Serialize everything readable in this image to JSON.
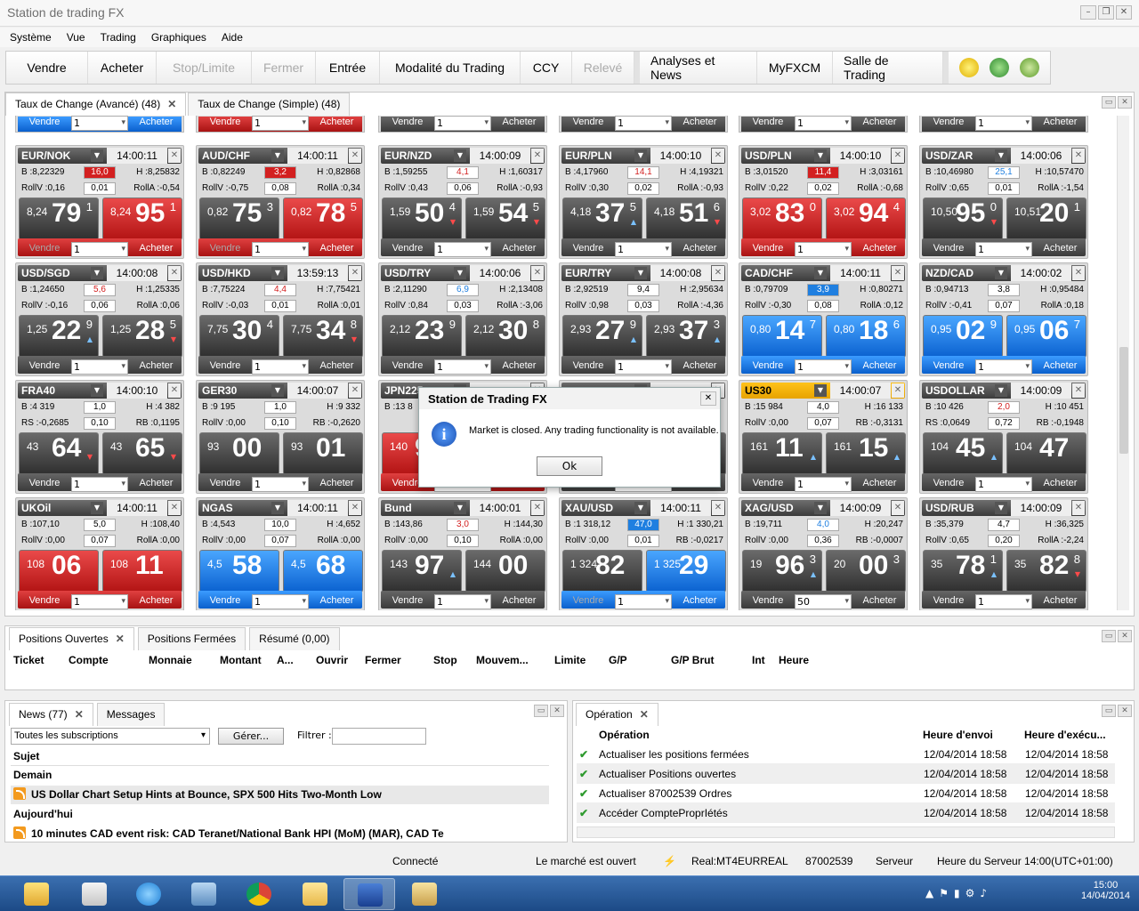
{
  "window": {
    "title": "Station de trading FX"
  },
  "menu": [
    "Système",
    "Vue",
    "Trading",
    "Graphiques",
    "Aide"
  ],
  "toolbar": {
    "buttons": [
      {
        "label": "Vendre",
        "enabled": true
      },
      {
        "label": "Acheter",
        "enabled": true
      },
      {
        "label": "Stop/Limite",
        "enabled": false
      },
      {
        "label": "Fermer",
        "enabled": false
      },
      {
        "label": "Entrée",
        "enabled": true
      },
      {
        "label": "Modalité du Trading",
        "enabled": true
      },
      {
        "label": "CCY",
        "enabled": true
      },
      {
        "label": "Relevé",
        "enabled": false
      }
    ],
    "buttons2": [
      "Analyses et News",
      "MyFXCM",
      "Salle de Trading"
    ],
    "icons": [
      "lightbulb-icon",
      "refresh-icon",
      "settings-gears-icon"
    ]
  },
  "rates_tabs": [
    {
      "label": "Taux de Change (Avancé) (48)",
      "close": "✕"
    },
    {
      "label": "Taux de Change (Simple) (48)",
      "close": ""
    }
  ],
  "common": {
    "sell": "Vendre",
    "buy": "Acheter",
    "qty": "1"
  },
  "top_strips": [
    {
      "sell": "Vendre",
      "qty": "1",
      "buy": "Acheter",
      "color": "blue"
    },
    {
      "sell": "Vendre",
      "qty": "1",
      "buy": "Acheter",
      "color": "red"
    },
    {
      "sell": "Vendre",
      "qty": "1",
      "buy": "Acheter",
      "color": "gray"
    },
    {
      "sell": "Vendre",
      "qty": "1",
      "buy": "Acheter",
      "color": "gray"
    },
    {
      "sell": "Vendre",
      "qty": "1",
      "buy": "Acheter",
      "color": "gray"
    },
    {
      "sell": "Vendre",
      "qty": "1",
      "buy": "Acheter",
      "color": "gray"
    }
  ],
  "cards": [
    {
      "sym": "EUR/NOK",
      "time": "14:00:11",
      "bL": "B :8,22329",
      "mid1": "16,0",
      "mid1c": "red",
      "hR": "H :8,25832",
      "r2L": "RollV :0,16",
      "mid2": "0,01",
      "r2R": "RollA :-0,54",
      "sBig": "8,24",
      "sPip": "79",
      "sFr": "1",
      "sCol": "gray",
      "sAr": "",
      "bBig": "8,24",
      "bPip": "95",
      "bFr": "1",
      "bCol": "red",
      "bAr": "",
      "foot": "red",
      "qty": "1",
      "sellDim": true
    },
    {
      "sym": "AUD/CHF",
      "time": "14:00:11",
      "bL": "B :0,82249",
      "mid1": "3,2",
      "mid1c": "red",
      "hR": "H :0,82868",
      "r2L": "RollV :-0,75",
      "mid2": "0,08",
      "r2R": "RollA :0,34",
      "sBig": "0,82",
      "sPip": "75",
      "sFr": "3",
      "sCol": "gray",
      "sAr": "",
      "bBig": "0,82",
      "bPip": "78",
      "bFr": "5",
      "bCol": "red",
      "bAr": "",
      "foot": "red",
      "qty": "1",
      "sellDim": true
    },
    {
      "sym": "EUR/NZD",
      "time": "14:00:09",
      "bL": "B :1,59255",
      "mid1": "4,1",
      "mid1c": "redt",
      "hR": "H :1,60317",
      "r2L": "RollV :0,43",
      "mid2": "0,06",
      "r2R": "RollA :-0,93",
      "sBig": "1,59",
      "sPip": "50",
      "sFr": "4",
      "sCol": "gray",
      "sAr": "dn",
      "bBig": "1,59",
      "bPip": "54",
      "bFr": "5",
      "bCol": "gray",
      "bAr": "dn",
      "foot": "gray",
      "qty": "1",
      "sellDim": false
    },
    {
      "sym": "EUR/PLN",
      "time": "14:00:10",
      "bL": "B :4,17960",
      "mid1": "14,1",
      "mid1c": "redt",
      "hR": "H :4,19321",
      "r2L": "RollV :0,30",
      "mid2": "0,02",
      "r2R": "RollA :-0,93",
      "sBig": "4,18",
      "sPip": "37",
      "sFr": "5",
      "sCol": "gray",
      "sAr": "up",
      "bBig": "4,18",
      "bPip": "51",
      "bFr": "6",
      "bCol": "gray",
      "bAr": "dn",
      "foot": "gray",
      "qty": "1",
      "sellDim": false
    },
    {
      "sym": "USD/PLN",
      "time": "14:00:10",
      "bL": "B :3,01520",
      "mid1": "11,4",
      "mid1c": "red",
      "hR": "H :3,03161",
      "r2L": "RollV :0,22",
      "mid2": "0,02",
      "r2R": "RollA :-0,68",
      "sBig": "3,02",
      "sPip": "83",
      "sFr": "0",
      "sCol": "red",
      "sAr": "",
      "bBig": "3,02",
      "bPip": "94",
      "bFr": "4",
      "bCol": "red",
      "bAr": "",
      "foot": "red",
      "qty": "1",
      "sellDim": false
    },
    {
      "sym": "USD/ZAR",
      "time": "14:00:06",
      "bL": "B :10,46980",
      "mid1": "25,1",
      "mid1c": "bluet",
      "hR": "H :10,57470",
      "r2L": "RollV :0,65",
      "mid2": "0,01",
      "r2R": "RollA :-1,54",
      "sBig": "10,50",
      "sPip": "95",
      "sFr": "0",
      "sCol": "gray",
      "sAr": "dn",
      "bBig": "10,51",
      "bPip": "20",
      "bFr": "1",
      "bCol": "gray",
      "bAr": "",
      "foot": "gray",
      "qty": "1",
      "sellDim": false
    },
    {
      "sym": "USD/SGD",
      "time": "14:00:08",
      "bL": "B :1,24650",
      "mid1": "5,6",
      "mid1c": "redt",
      "hR": "H :1,25335",
      "r2L": "RollV :-0,16",
      "mid2": "0,06",
      "r2R": "RollA :0,06",
      "sBig": "1,25",
      "sPip": "22",
      "sFr": "9",
      "sCol": "gray",
      "sAr": "up",
      "bBig": "1,25",
      "bPip": "28",
      "bFr": "5",
      "bCol": "gray",
      "bAr": "dn",
      "foot": "gray",
      "qty": "1",
      "sellDim": false
    },
    {
      "sym": "USD/HKD",
      "time": "13:59:13",
      "bL": "B :7,75224",
      "mid1": "4,4",
      "mid1c": "redt",
      "hR": "H :7,75421",
      "r2L": "RollV :-0,03",
      "mid2": "0,01",
      "r2R": "RollA :0,01",
      "sBig": "7,75",
      "sPip": "30",
      "sFr": "4",
      "sCol": "gray",
      "sAr": "",
      "bBig": "7,75",
      "bPip": "34",
      "bFr": "8",
      "bCol": "gray",
      "bAr": "dn",
      "foot": "gray",
      "qty": "1",
      "sellDim": false
    },
    {
      "sym": "USD/TRY",
      "time": "14:00:06",
      "bL": "B :2,11290",
      "mid1": "6,9",
      "mid1c": "bluet",
      "hR": "H :2,13408",
      "r2L": "RollV :0,84",
      "mid2": "0,03",
      "r2R": "RollA :-3,06",
      "sBig": "2,12",
      "sPip": "23",
      "sFr": "9",
      "sCol": "gray",
      "sAr": "",
      "bBig": "2,12",
      "bPip": "30",
      "bFr": "8",
      "bCol": "gray",
      "bAr": "",
      "foot": "gray",
      "qty": "1",
      "sellDim": false
    },
    {
      "sym": "EUR/TRY",
      "time": "14:00:08",
      "bL": "B :2,92519",
      "mid1": "9,4",
      "mid1c": "",
      "hR": "H :2,95634",
      "r2L": "RollV :0,98",
      "mid2": "0,03",
      "r2R": "RollA :-4,36",
      "sBig": "2,93",
      "sPip": "27",
      "sFr": "9",
      "sCol": "gray",
      "sAr": "up",
      "bBig": "2,93",
      "bPip": "37",
      "bFr": "3",
      "bCol": "gray",
      "bAr": "up",
      "foot": "gray",
      "qty": "1",
      "sellDim": false
    },
    {
      "sym": "CAD/CHF",
      "time": "14:00:11",
      "bL": "B :0,79709",
      "mid1": "3,9",
      "mid1c": "blue",
      "hR": "H :0,80271",
      "r2L": "RollV :-0,30",
      "mid2": "0,08",
      "r2R": "RollA :0,12",
      "sBig": "0,80",
      "sPip": "14",
      "sFr": "7",
      "sCol": "blue",
      "sAr": "",
      "bBig": "0,80",
      "bPip": "18",
      "bFr": "6",
      "bCol": "blue",
      "bAr": "",
      "foot": "blue",
      "qty": "1",
      "sellDim": false
    },
    {
      "sym": "NZD/CAD",
      "time": "14:00:02",
      "bL": "B :0,94713",
      "mid1": "3,8",
      "mid1c": "",
      "hR": "H :0,95484",
      "r2L": "RollV :-0,41",
      "mid2": "0,07",
      "r2R": "RollA :0,18",
      "sBig": "0,95",
      "sPip": "02",
      "sFr": "9",
      "sCol": "blue",
      "sAr": "",
      "bBig": "0,95",
      "bPip": "06",
      "bFr": "7",
      "bCol": "blue",
      "bAr": "",
      "foot": "blue",
      "qty": "1",
      "sellDim": false
    },
    {
      "sym": "FRA40",
      "time": "14:00:10",
      "bL": "B :4 319",
      "mid1": "1,0",
      "mid1c": "",
      "hR": "H :4 382",
      "r2L": "RS :-0,2685",
      "mid2": "0,10",
      "r2R": "RB :0,1195",
      "sBig": "43",
      "sPip": "64",
      "sFr": "",
      "sCol": "gray",
      "sAr": "dn",
      "bBig": "43",
      "bPip": "65",
      "bFr": "",
      "bCol": "gray",
      "bAr": "dn",
      "foot": "gray",
      "qty": "1",
      "sellDim": false
    },
    {
      "sym": "GER30",
      "time": "14:00:07",
      "bL": "B :9 195",
      "mid1": "1,0",
      "mid1c": "",
      "hR": "H :9 332",
      "r2L": "RollV :0,00",
      "mid2": "0,10",
      "r2R": "RB :-0,2620",
      "sBig": "93",
      "sPip": "00",
      "sFr": "",
      "sCol": "gray",
      "sAr": "",
      "bBig": "93",
      "bPip": "01",
      "bFr": "",
      "bCol": "gray",
      "bAr": "",
      "foot": "gray",
      "qty": "1",
      "sellDim": false
    },
    {
      "sym": "JPN225",
      "time": "",
      "bL": "B :13 8",
      "mid1": "",
      "mid1c": "",
      "hR": "",
      "r2L": "",
      "mid2": "",
      "r2R": "",
      "sBig": "140",
      "sPip": "9",
      "sFr": "",
      "sCol": "red",
      "sAr": "",
      "bBig": "",
      "bPip": "",
      "bFr": "",
      "bCol": "gray",
      "bAr": "",
      "foot": "red",
      "qty": "1",
      "sellDim": false
    },
    {
      "sym": "",
      "time": "",
      "bL": "",
      "mid1": "",
      "mid1c": "",
      "hR": "",
      "r2L": "",
      "mid2": "",
      "r2R": "",
      "sBig": "",
      "sPip": "",
      "sFr": "",
      "sCol": "gray",
      "sAr": "",
      "bBig": "",
      "bPip": "",
      "bFr": "",
      "bCol": "gray",
      "bAr": "",
      "foot": "gray",
      "qty": "1",
      "sellDim": false
    },
    {
      "sym": "US30",
      "time": "14:00:07",
      "bL": "B :15 984",
      "mid1": "4,0",
      "mid1c": "",
      "hR": "H :16 133",
      "r2L": "RollV :0,00",
      "mid2": "0,07",
      "r2R": "RB :-0,3131",
      "sBig": "161",
      "sPip": "11",
      "sFr": "",
      "sCol": "gray",
      "sAr": "up",
      "bBig": "161",
      "bPip": "15",
      "bFr": "",
      "bCol": "gray",
      "bAr": "up",
      "foot": "gray",
      "qty": "1",
      "sellDim": false,
      "gold": true
    },
    {
      "sym": "USDOLLAR",
      "time": "14:00:09",
      "bL": "B :10 426",
      "mid1": "2,0",
      "mid1c": "redt",
      "hR": "H :10 451",
      "r2L": "RS :0,0649",
      "mid2": "0,72",
      "r2R": "RB :-0,1948",
      "sBig": "104",
      "sPip": "45",
      "sFr": "",
      "sCol": "gray",
      "sAr": "up",
      "bBig": "104",
      "bPip": "47",
      "bFr": "",
      "bCol": "gray",
      "bAr": "",
      "foot": "gray",
      "qty": "1",
      "sellDim": false
    },
    {
      "sym": "UKOil",
      "time": "14:00:11",
      "bL": "B :107,10",
      "mid1": "5,0",
      "mid1c": "",
      "hR": "H :108,40",
      "r2L": "RollV :0,00",
      "mid2": "0,07",
      "r2R": "RollA :0,00",
      "sBig": "108",
      "sPip": "06",
      "sFr": "",
      "sCol": "red",
      "sAr": "",
      "bBig": "108",
      "bPip": "11",
      "bFr": "",
      "bCol": "red",
      "bAr": "",
      "foot": "red",
      "qty": "1",
      "sellDim": false
    },
    {
      "sym": "NGAS",
      "time": "14:00:11",
      "bL": "B :4,543",
      "mid1": "10,0",
      "mid1c": "",
      "hR": "H :4,652",
      "r2L": "RollV :0,00",
      "mid2": "0,07",
      "r2R": "RollA :0,00",
      "sBig": "4,5",
      "sPip": "58",
      "sFr": "",
      "sCol": "blue",
      "sAr": "",
      "bBig": "4,5",
      "bPip": "68",
      "bFr": "",
      "bCol": "blue",
      "bAr": "",
      "foot": "blue",
      "qty": "1",
      "sellDim": false
    },
    {
      "sym": "Bund",
      "time": "14:00:01",
      "bL": "B :143,86",
      "mid1": "3,0",
      "mid1c": "redt",
      "hR": "H :144,30",
      "r2L": "RollV :0,00",
      "mid2": "0,10",
      "r2R": "RollA :0,00",
      "sBig": "143",
      "sPip": "97",
      "sFr": "",
      "sCol": "gray",
      "sAr": "up",
      "bBig": "144",
      "sPip2": "",
      "bPip": "00",
      "bFr": "",
      "bCol": "gray",
      "bAr": "",
      "foot": "gray",
      "qty": "1",
      "sellDim": false
    },
    {
      "sym": "XAU/USD",
      "time": "14:00:11",
      "bL": "B :1 318,12",
      "mid1": "47,0",
      "mid1c": "blue",
      "hR": "H :1 330,21",
      "r2L": "RollV :0,00",
      "mid2": "0,01",
      "r2R": "RB :-0,0217",
      "sBig": "1 324",
      "sPip": "82",
      "sFr": "",
      "sCol": "gray",
      "sAr": "",
      "bBig": "1 325",
      "bPip": "29",
      "bFr": "",
      "bCol": "blue",
      "bAr": "",
      "foot": "blue",
      "qty": "1",
      "sellDim": true
    },
    {
      "sym": "XAG/USD",
      "time": "14:00:09",
      "bL": "B :19,711",
      "mid1": "4,0",
      "mid1c": "bluet",
      "hR": "H :20,247",
      "r2L": "RollV :0,00",
      "mid2": "0,36",
      "r2R": "RB :-0,0007",
      "sBig": "19",
      "sPip": "96",
      "sFr": "3",
      "sCol": "gray",
      "sAr": "up",
      "bBig": "20",
      "bPip": "00",
      "bFr": "3",
      "bCol": "gray",
      "bAr": "",
      "foot": "gray",
      "qty": "50",
      "sellDim": false
    },
    {
      "sym": "USD/RUB",
      "time": "14:00:09",
      "bL": "B :35,379",
      "mid1": "4,7",
      "mid1c": "",
      "hR": "H :36,325",
      "r2L": "RollV :0,65",
      "mid2": "0,20",
      "r2R": "RollA :-2,24",
      "sBig": "35",
      "sPip": "78",
      "sFr": "1",
      "sCol": "gray",
      "sAr": "up",
      "bBig": "35",
      "bPip": "82",
      "bFr": "8",
      "bCol": "gray",
      "bAr": "dn",
      "foot": "gray",
      "qty": "1",
      "sellDim": false
    }
  ],
  "dialog": {
    "title": "Station de Trading FX",
    "message": "Market is closed. Any trading functionality is not available.",
    "ok": "Ok",
    "close": "✕"
  },
  "positions": {
    "tabs": [
      {
        "label": "Positions Ouvertes",
        "close": "✕"
      },
      {
        "label": "Positions Fermées"
      },
      {
        "label": "Résumé (0,00)"
      }
    ],
    "columns": [
      "Ticket",
      "Compte",
      "Monnaie",
      "Montant",
      "A...",
      "Ouvrir",
      "Fermer",
      "Stop",
      "Mouvem...",
      "Limite",
      "G/P",
      "G/P Brut",
      "Int",
      "Heure"
    ]
  },
  "news": {
    "tabs": [
      {
        "label": "News (77)",
        "close": "✕"
      },
      {
        "label": "Messages"
      }
    ],
    "subscription": "Toutes les subscriptions",
    "manage": "Gérer...",
    "filter_label": "Filtrer :",
    "filter_value": "",
    "col": "Sujet",
    "rows": [
      {
        "text": "Demain",
        "type": "group"
      },
      {
        "text": "US Dollar Chart Setup Hints at Bounce, SPX 500 Hits Two-Month Low",
        "type": "item"
      },
      {
        "text": "Aujourd'hui",
        "type": "group"
      },
      {
        "text": "10 minutes CAD event risk: CAD Teranet/National Bank HPI (MoM) (MAR), CAD Te",
        "type": "item"
      }
    ]
  },
  "operations": {
    "tab": {
      "label": "Opération",
      "close": "✕"
    },
    "columns": [
      "Opération",
      "Heure d'envoi",
      "Heure d'exécu..."
    ],
    "rows": [
      {
        "op": "Actualiser les positions fermées",
        "sent": "12/04/2014 18:58",
        "exec": "12/04/2014 18:58"
      },
      {
        "op": "Actualiser Positions ouvertes",
        "sent": "12/04/2014 18:58",
        "exec": "12/04/2014 18:58"
      },
      {
        "op": "Actualiser 87002539 Ordres",
        "sent": "12/04/2014 18:58",
        "exec": "12/04/2014 18:58"
      },
      {
        "op": "Accéder CompteProprIétés",
        "sent": "12/04/2014 18:58",
        "exec": "12/04/2014 18:58"
      }
    ]
  },
  "status": {
    "connected": "Connecté",
    "market": "Le marché est ouvert",
    "account_type": "Real:MT4EURREAL",
    "account": "87002539",
    "server": "Serveur",
    "server_time": "Heure du Serveur 14:00(UTC+01:00)"
  },
  "taskbar": {
    "time": "15:00",
    "date": "14/04/2014",
    "apps": [
      "explorer-icon",
      "paint-icon",
      "ie-icon",
      "control-panel-icon",
      "chrome-icon",
      "folder-icon",
      "fxcm-icon",
      "display-icon"
    ]
  }
}
